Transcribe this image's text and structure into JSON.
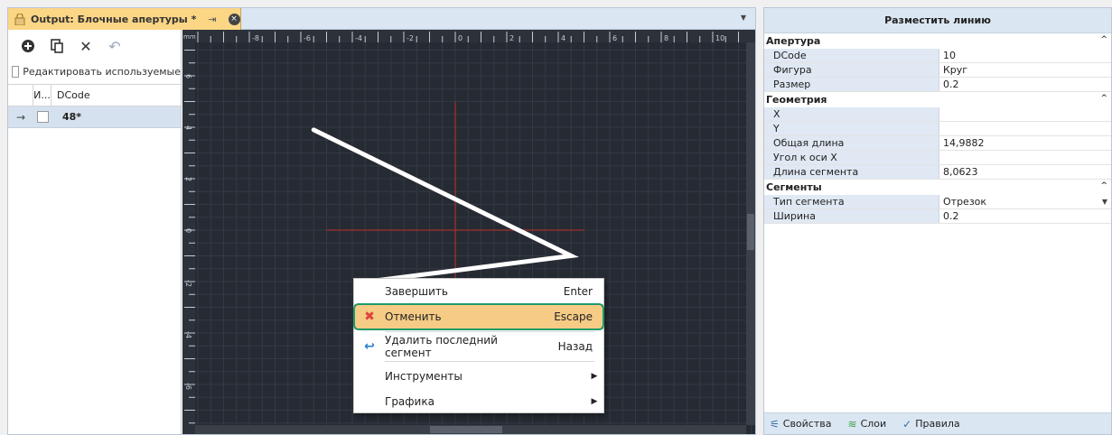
{
  "document_tab": {
    "title": "Output: Блочные апертуры *",
    "pin_glyph": "⇥",
    "close_glyph": "×"
  },
  "aperture_panel": {
    "toolbar": {
      "add_glyph": "⊕",
      "copy_glyph": "⎘",
      "delete_glyph": "✕",
      "undo_glyph": "↶"
    },
    "edit_used_label": "Редактировать используемые",
    "columns": [
      "И...",
      "DCode"
    ],
    "rows": [
      {
        "arrow": "→",
        "dcode": "48*"
      }
    ]
  },
  "canvas": {
    "unit_label": "mm",
    "x_ticks": [
      {
        "value": -8,
        "label": "-8"
      },
      {
        "value": -6,
        "label": "-6"
      },
      {
        "value": -4,
        "label": "-4"
      },
      {
        "value": -2,
        "label": "-2"
      },
      {
        "value": 0,
        "label": "0"
      },
      {
        "value": 2,
        "label": "2"
      },
      {
        "value": 4,
        "label": "4"
      },
      {
        "value": 6,
        "label": "6"
      },
      {
        "value": 8,
        "label": "8"
      },
      {
        "value": 10,
        "label": "10"
      }
    ],
    "y_ticks": [
      {
        "value": 6,
        "label": "6"
      },
      {
        "value": 4,
        "label": "4"
      },
      {
        "value": 2,
        "label": "2"
      },
      {
        "value": 0,
        "label": "0"
      },
      {
        "value": -2,
        "label": "-2"
      },
      {
        "value": -4,
        "label": "-4"
      },
      {
        "value": -6,
        "label": "-6"
      },
      {
        "value": -8,
        "label": "-8"
      }
    ],
    "colors": {
      "background": "#262b33",
      "grid": "#333944",
      "trace": "#ffffff",
      "crosshair": "#c0302c"
    }
  },
  "context_menu": {
    "items": [
      {
        "label": "Завершить",
        "shortcut": "Enter",
        "icon": ""
      },
      {
        "label": "Отменить",
        "shortcut": "Escape",
        "icon": "✖"
      },
      {
        "label": "Удалить последний сегмент",
        "shortcut": "Назад",
        "icon": "↩"
      },
      {
        "label": "Инструменты",
        "submenu": "▶"
      },
      {
        "label": "Графика",
        "submenu": "▶"
      }
    ]
  },
  "properties": {
    "title": "Разместить линию",
    "categories": [
      {
        "name": "Апертура",
        "rows": [
          {
            "name": "DCode",
            "value": "10"
          },
          {
            "name": "Фигура",
            "value": "Круг"
          },
          {
            "name": "Размер",
            "value": "0.2"
          }
        ]
      },
      {
        "name": "Геометрия",
        "rows": [
          {
            "name": "X",
            "value": ""
          },
          {
            "name": "Y",
            "value": ""
          },
          {
            "name": "Общая длина",
            "value": "14,9882"
          },
          {
            "name": "Угол к оси X",
            "value": ""
          },
          {
            "name": "Длина сегмента",
            "value": "8,0623"
          }
        ]
      },
      {
        "name": "Сегменты",
        "rows": [
          {
            "name": "Тип сегмента",
            "value": "Отрезок"
          },
          {
            "name": "Ширина",
            "value": "0.2"
          }
        ]
      }
    ],
    "bottom_tabs": [
      {
        "label": "Свойства",
        "icon": "⚟"
      },
      {
        "label": "Слои",
        "icon": "≋"
      },
      {
        "label": "Правила",
        "icon": "✓"
      }
    ]
  }
}
